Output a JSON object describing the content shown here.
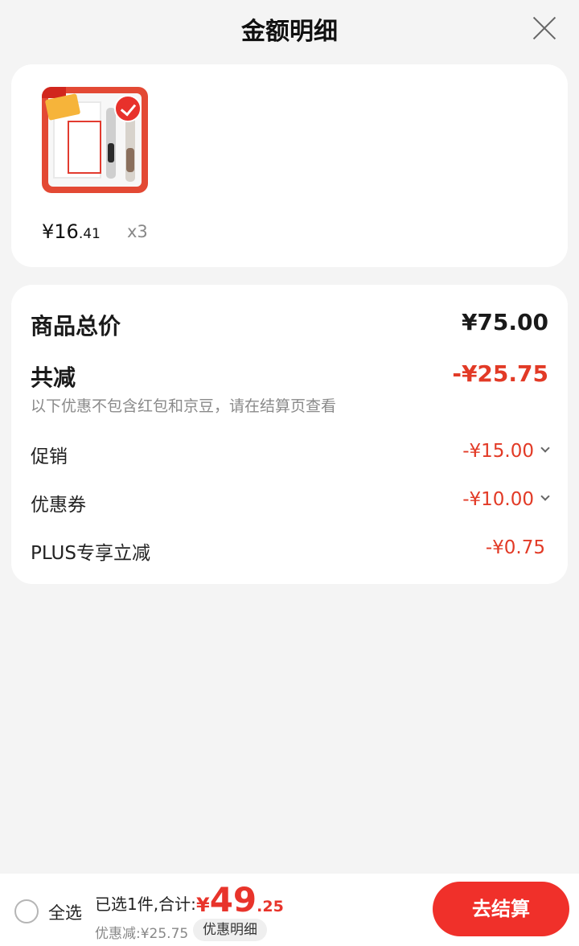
{
  "header": {
    "title": "金额明细"
  },
  "product": {
    "price_int": "¥16",
    "price_dec": ".41",
    "quantity": "x3"
  },
  "summary": {
    "total_label": "商品总价",
    "total_value": "¥75.00",
    "discount_label": "共减",
    "discount_value": "-¥25.75",
    "note": "以下优惠不包含红包和京豆，请在结算页查看",
    "items": [
      {
        "label": "促销",
        "value": "-¥15.00",
        "expandable": true
      },
      {
        "label": "优惠券",
        "value": "-¥10.00",
        "expandable": true
      },
      {
        "label": "PLUS专享立减",
        "value": "-¥0.75",
        "expandable": false
      }
    ]
  },
  "bottom": {
    "select_all": "全选",
    "selected_text": "已选1件,合计:",
    "total_currency": "¥",
    "total_int": "49",
    "total_dec": ".25",
    "saving_text": "优惠减:¥25.75",
    "detail_chip": "优惠明细",
    "checkout": "去结算"
  },
  "colors": {
    "accent_red": "#e8342b",
    "background": "#f4f4f4"
  }
}
